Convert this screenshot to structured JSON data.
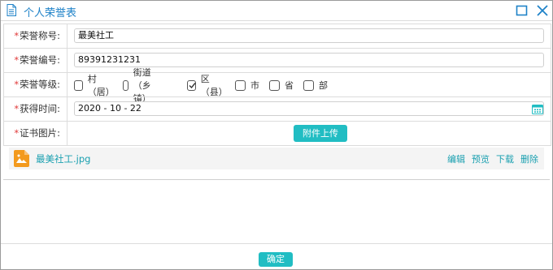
{
  "window": {
    "title": "个人荣誉表"
  },
  "icons": {
    "doc": "document-icon",
    "maximize": "maximize-icon",
    "close": "close-icon",
    "calendar": "calendar-icon",
    "image_file": "image-file-icon"
  },
  "colors": {
    "accent": "#21bdc3",
    "title": "#1e82c8",
    "required": "#e03a3a",
    "link": "#1aa0b0",
    "file_icon": "#f39a1e"
  },
  "form": {
    "required_mark": "*",
    "honor_name": {
      "label": "荣誉称号:",
      "value": "最美社工"
    },
    "honor_number": {
      "label": "荣誉编号:",
      "value": "89391231231"
    },
    "honor_level": {
      "label": "荣誉等级:",
      "options": [
        {
          "label": "村（居）",
          "checked": false
        },
        {
          "label": "街道（乡镇）",
          "checked": false
        },
        {
          "label": "区（县）",
          "checked": true
        },
        {
          "label": "市",
          "checked": false
        },
        {
          "label": "省",
          "checked": false
        },
        {
          "label": "部",
          "checked": false
        }
      ]
    },
    "obtain_time": {
      "label": "获得时间:",
      "value": "2020 - 10 - 22"
    },
    "certificate": {
      "label": "证书图片:",
      "upload_label": "附件上传"
    }
  },
  "attachment": {
    "file_name": "最美社工.jpg",
    "actions": [
      "编辑",
      "预览",
      "下载",
      "删除"
    ]
  },
  "footer": {
    "confirm_label": "确定"
  }
}
